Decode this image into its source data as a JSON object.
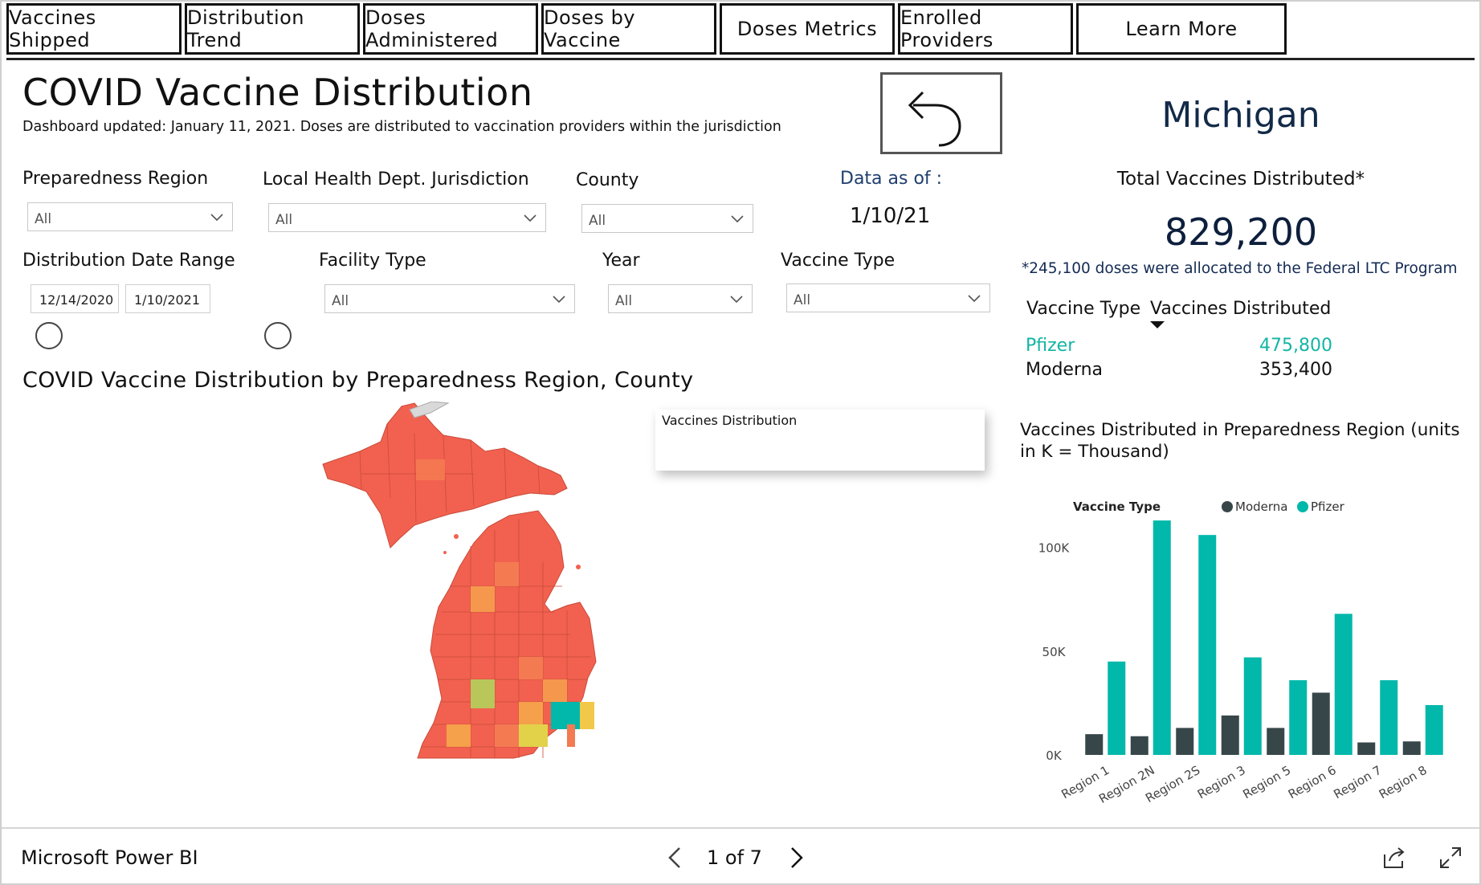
{
  "tabs": [
    "Vaccines Shipped",
    "Distribution Trend",
    "Doses Administered",
    "Doses by Vaccine",
    "Doses Metrics",
    "Enrolled Providers",
    "Learn More"
  ],
  "title": "COVID Vaccine Distribution",
  "subtitle": "Dashboard updated: January 11, 2021. Doses are distributed to vaccination providers within the jurisdiction",
  "state": "Michigan",
  "total_label": "Total Vaccines Distributed*",
  "total_value": "829,200",
  "ltc_note": "*245,100 doses were allocated to the Federal LTC Program",
  "filters": {
    "preparedness_region": {
      "label": "Preparedness Region",
      "value": "All"
    },
    "lhd_jurisdiction": {
      "label": "Local Health Dept. Jurisdiction",
      "value": "All"
    },
    "county": {
      "label": "County",
      "value": "All"
    },
    "date_range": {
      "label": "Distribution Date Range",
      "start": "12/14/2020",
      "end": "1/10/2021"
    },
    "facility_type": {
      "label": "Facility Type",
      "value": "All"
    },
    "year": {
      "label": "Year",
      "value": "All"
    },
    "vaccine_type": {
      "label": "Vaccine Type",
      "value": "All"
    }
  },
  "data_as_of": {
    "label": "Data as of :",
    "value": "1/10/21"
  },
  "vaccine_table": {
    "headers": [
      "Vaccine Type",
      "Vaccines Distributed"
    ],
    "rows": [
      {
        "type": "Pfizer",
        "value": "475,800",
        "color": "#13b5a4"
      },
      {
        "type": "Moderna",
        "value": "353,400",
        "color": "#111111"
      }
    ]
  },
  "map": {
    "title": "COVID Vaccine Distribution by Preparedness Region, County",
    "tooltip_title": "Vaccines Distribution"
  },
  "chart_title": "Vaccines Distributed in Preparedness Region (units in K = Thousand)",
  "chart_data": {
    "type": "bar",
    "legend_title": "Vaccine Type",
    "legend_position": "top",
    "categories": [
      "Region 1",
      "Region 2N",
      "Region 2S",
      "Region 3",
      "Region 5",
      "Region 6",
      "Region 7",
      "Region 8"
    ],
    "series": [
      {
        "name": "Moderna",
        "color": "#374649",
        "values": [
          10,
          9,
          13,
          19,
          13,
          30,
          6,
          6.5
        ]
      },
      {
        "name": "Pfizer",
        "color": "#01b8aa",
        "values": [
          45,
          113,
          106,
          47,
          36,
          68,
          36,
          24
        ]
      }
    ],
    "yticks": [
      "0K",
      "50K",
      "100K"
    ],
    "ylim": [
      0,
      120
    ]
  },
  "footer": {
    "brand": "Microsoft Power BI",
    "pager": "1 of 7"
  },
  "colors": {
    "teal": "#01b8aa",
    "dark": "#374649",
    "navy": "#132a48"
  }
}
